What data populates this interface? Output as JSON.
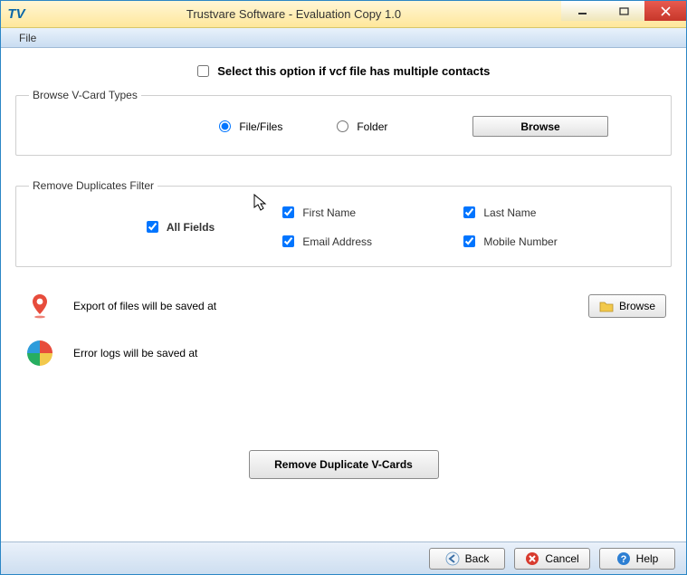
{
  "window": {
    "title": "Trustvare Software - Evaluation Copy 1.0",
    "logo_text": "TV"
  },
  "menu": {
    "file": "File"
  },
  "multi_contacts": {
    "label": "Select this option if vcf file has multiple contacts",
    "checked": false
  },
  "browse_group": {
    "legend": "Browse V-Card Types",
    "radio_files": "File/Files",
    "radio_folder": "Folder",
    "selected": "files",
    "browse_btn": "Browse"
  },
  "filter_group": {
    "legend": "Remove Duplicates Filter",
    "all_fields": "All Fields",
    "first_name": "First Name",
    "last_name": "Last Name",
    "email": "Email Address",
    "mobile": "Mobile Number",
    "checked": {
      "all_fields": true,
      "first_name": true,
      "last_name": true,
      "email": true,
      "mobile": true
    }
  },
  "export_row": {
    "label": "Export of files will be saved at",
    "browse_btn": "Browse"
  },
  "log_row": {
    "label": "Error logs will be saved at"
  },
  "primary_action": "Remove Duplicate V-Cards",
  "footer": {
    "back": "Back",
    "cancel": "Cancel",
    "help": "Help"
  }
}
